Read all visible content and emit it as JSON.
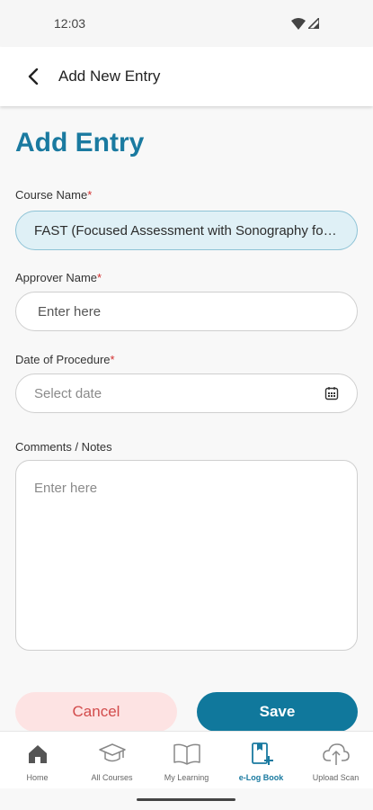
{
  "status_bar": {
    "time": "12:03"
  },
  "app_bar": {
    "title": "Add New Entry"
  },
  "page": {
    "title": "Add Entry"
  },
  "form": {
    "course": {
      "label": "Course Name",
      "required_mark": "*",
      "value": "FAST (Focused Assessment with Sonography for Trauma)"
    },
    "approver": {
      "label": "Approver Name",
      "required_mark": "*",
      "placeholder": "Enter here",
      "value": ""
    },
    "date": {
      "label": "Date of Procedure",
      "required_mark": "*",
      "placeholder": "Select date",
      "icon": "calendar-icon"
    },
    "comments": {
      "label": "Comments / Notes",
      "placeholder": "Enter here"
    }
  },
  "actions": {
    "cancel_label": "Cancel",
    "save_label": "Save"
  },
  "bottom_nav": {
    "active_color": "#1a7aa0",
    "items": [
      {
        "label": "Home",
        "icon": "home-icon"
      },
      {
        "label": "All Courses",
        "icon": "graduation-cap-icon"
      },
      {
        "label": "My Learning",
        "icon": "book-icon"
      },
      {
        "label": "e-Log Book",
        "icon": "logbook-add-icon",
        "active": true
      },
      {
        "label": "Upload Scan",
        "icon": "cloud-upload-icon"
      }
    ]
  },
  "colors": {
    "primary": "#10789c",
    "title": "#1a7aa0",
    "cancel_bg": "#fde3e3",
    "cancel_text": "#d24b4b",
    "required": "#d32f2f",
    "filled_field_bg": "#dff0f6"
  }
}
